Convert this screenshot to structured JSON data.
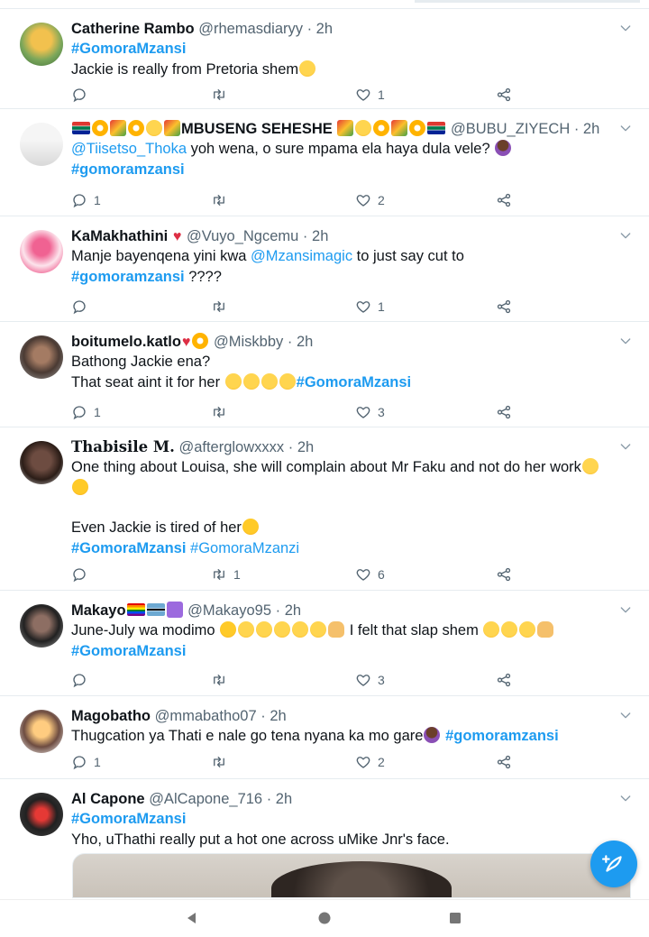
{
  "tweets": [
    {
      "name": "Catherine Rambo",
      "handle": "@rhemasdiaryy",
      "time": "2h",
      "lines": [
        "#GomoraMzansi",
        "Jackie is really from Pretoria shem"
      ],
      "replies": "",
      "retweets": "",
      "likes": "1"
    },
    {
      "name": "MBUSENG SEHESHE",
      "handle": "@BUBU_ZIYECH",
      "time": "2h",
      "mention": "@Tiisetso_Thoka",
      "text": " yoh wena, o sure mpama ela haya dula vele? ",
      "tag": "#gomoramzansi",
      "replies": "1",
      "retweets": "",
      "likes": "2"
    },
    {
      "name": "KaMakhathini",
      "handle": "@Vuyo_Ngcemu",
      "time": "2h",
      "text_a": "Manje bayenqena yini kwa ",
      "mention": "@Mzansimagic",
      "text_b": " to just say cut to",
      "tag": "#gomoramzansi",
      "text_c": " ????",
      "replies": "",
      "retweets": "",
      "likes": "1"
    },
    {
      "name": "boitumelo.katlo",
      "handle": "@Miskbby",
      "time": "2h",
      "line1": "Bathong Jackie ena?",
      "line2": "That seat aint it for her ",
      "tag": "#GomoraMzansi",
      "replies": "1",
      "retweets": "",
      "likes": "3"
    },
    {
      "name": "Thabisile M.",
      "handle": "@afterglowxxxx",
      "time": "2h",
      "line1": "One thing about Louisa, she will complain about Mr Faku and not do her work",
      "line2": "Even Jackie is tired of her",
      "tag1": "#GomoraMzansi",
      "tag2": "#GomoraMzanzi",
      "replies": "",
      "retweets": "1",
      "likes": "6"
    },
    {
      "name": "Makayo",
      "handle": "@Makayo95",
      "time": "2h",
      "text_a": "June-July wa modimo ",
      "text_b": " I felt that slap shem ",
      "tag": "#GomoraMzansi",
      "replies": "",
      "retweets": "",
      "likes": "3"
    },
    {
      "name": "Magobatho",
      "handle": "@mmabatho07",
      "time": "2h",
      "text": "Thugcation ya Thati e nale go tena nyana ka mo gare",
      "tag": "#gomoramzansi",
      "replies": "1",
      "retweets": "",
      "likes": "2"
    },
    {
      "name": "Al Capone",
      "handle": "@AlCapone_716",
      "time": "2h",
      "tag": "#GomoraMzansi",
      "text": "Yho, uThathi really put a hot one across uMike Jnr's face."
    }
  ],
  "separator": " · ",
  "colors": {
    "accent": "#1d9bf0",
    "secondary_text": "#536471",
    "divider": "#e6ecf0"
  },
  "icons": [
    "reply-icon",
    "retweet-icon",
    "like-icon",
    "share-icon",
    "compose-icon",
    "more-icon",
    "back-icon",
    "home-icon",
    "recents-icon"
  ]
}
